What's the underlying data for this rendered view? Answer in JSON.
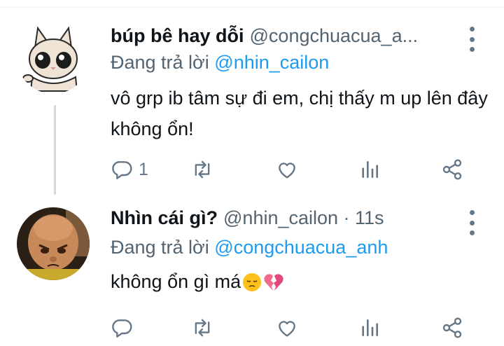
{
  "tweets": [
    {
      "name": "búp bê hay dỗi",
      "handle": "@congchuacua_a...",
      "reply_prefix": "Đang trả lời",
      "reply_to": "@nhin_cailon",
      "text": "vô grp ib tâm sự đi em, chị thấy m up lên đây không ổn!",
      "reply_count": "1"
    },
    {
      "name": "Nhìn cái gì?",
      "handle": "@nhin_cailon · 11s",
      "reply_prefix": "Đang trả lời",
      "reply_to": "@congchuacua_anh",
      "text": "không ổn gì má",
      "emojis": [
        "pensive-face-emoji",
        "broken-heart-emoji"
      ]
    }
  ],
  "icons": [
    "reply-icon",
    "retweet-icon",
    "like-icon",
    "stats-icon",
    "share-icon",
    "more-icon"
  ],
  "colors": {
    "text": "#0f1419",
    "muted": "#536471",
    "link": "#1d9bf0",
    "icon": "#657786",
    "thread": "#cfd9de"
  }
}
